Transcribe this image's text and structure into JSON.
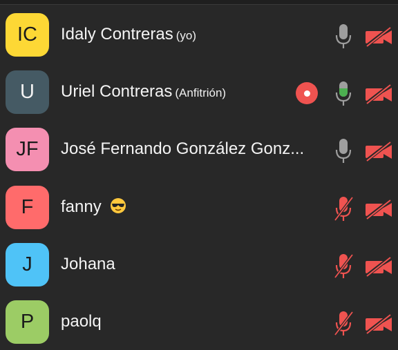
{
  "colors": {
    "background": "#282828",
    "mic_idle": "#9e9e9e",
    "mic_active": "#4caf50",
    "muted": "#ef5350"
  },
  "participants": [
    {
      "initials": "IC",
      "name": "Idaly Contreras",
      "tag": "(yo)",
      "avatar_color": "#fdd835",
      "mic": "idle",
      "recording": false,
      "emoji": ""
    },
    {
      "initials": "U",
      "name": "Uriel Contreras",
      "tag": "(Anfitrión)",
      "avatar_color": "#455a64",
      "mic": "active",
      "recording": true,
      "emoji": ""
    },
    {
      "initials": "JF",
      "name": "José Fernando González Gonz...",
      "tag": "",
      "avatar_color": "#f48fb1",
      "mic": "idle",
      "recording": false,
      "emoji": ""
    },
    {
      "initials": "F",
      "name": "fanny",
      "tag": "",
      "avatar_color": "#ff6b6b",
      "mic": "muted",
      "recording": false,
      "emoji": "😎"
    },
    {
      "initials": "J",
      "name": "Johana",
      "tag": "",
      "avatar_color": "#4fc3f7",
      "mic": "muted",
      "recording": false,
      "emoji": ""
    },
    {
      "initials": "P",
      "name": "paolq",
      "tag": "",
      "avatar_color": "#9ccc65",
      "mic": "muted",
      "recording": false,
      "emoji": ""
    }
  ],
  "icons": {
    "mic_idle": "microphone-icon",
    "mic_active": "microphone-active-icon",
    "mic_muted": "microphone-muted-icon",
    "camera_off": "video-off-icon",
    "recording": "recording-icon"
  }
}
